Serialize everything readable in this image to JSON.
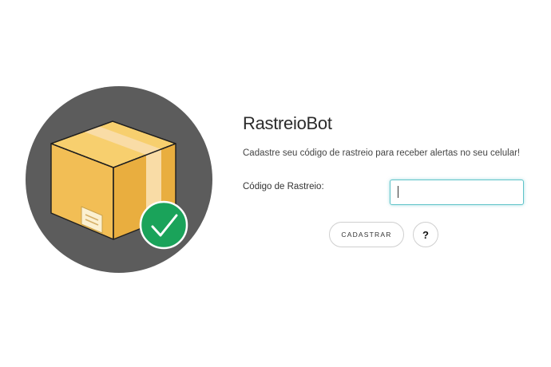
{
  "app": {
    "title": "RastreioBot",
    "subtitle": "Cadastre seu código de rastreio para receber alertas no seu celular!"
  },
  "form": {
    "label": "Código de Rastreio:",
    "input_value": "",
    "register_label": "CADASTRAR",
    "help_label": "?"
  },
  "illustration": {
    "icons": [
      "package-box-icon",
      "checkmark-icon"
    ],
    "colors": {
      "circle_bg": "#5c5c5c",
      "box_face": "#f2be55",
      "box_top": "#f7cf6e",
      "tape": "#f9dca6",
      "check_bg": "#1aa35a"
    }
  }
}
